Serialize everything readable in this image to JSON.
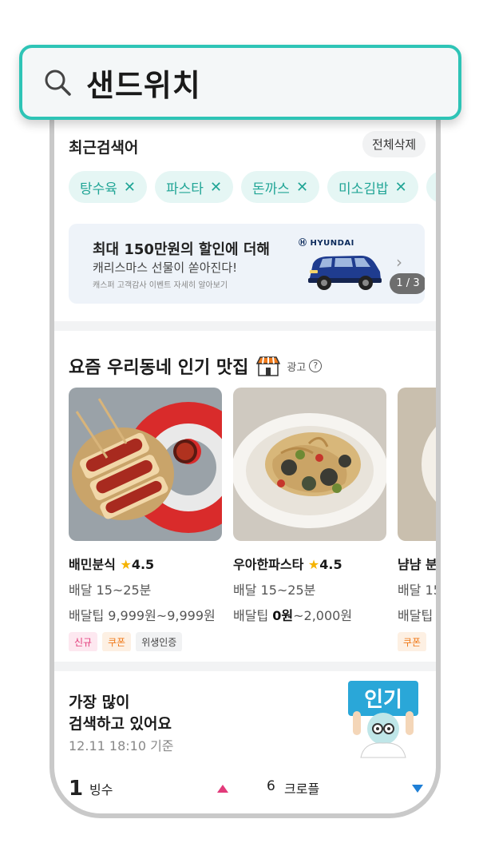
{
  "search": {
    "query": "샌드위치"
  },
  "recent": {
    "title": "최근검색어",
    "delete_all": "전체삭제",
    "chips": [
      "탕수육",
      "파스타",
      "돈까스",
      "미소김밥",
      "마"
    ]
  },
  "banner": {
    "title": "최대 150만원의 할인에 더해",
    "subtitle": "캐리스마스 선물이 쏟아진다!",
    "note": "캐스퍼 고객감사 이벤트 자세히 알아보기",
    "brand": "HYUNDAI",
    "page": "1 / 3"
  },
  "popular": {
    "title": "요즘 우리동네 인기 맛집",
    "ad_label": "광고",
    "cards": [
      {
        "name": "배민분식",
        "rating": "4.5",
        "delivery": "배달 15~25분",
        "tip_label": "배달팁",
        "tip": "9,999원~9,999원",
        "tip_bold": "",
        "badges": [
          "신규",
          "쿠폰",
          "위생인증"
        ]
      },
      {
        "name": "우아한파스타",
        "rating": "4.5",
        "delivery": "배달 15~25분",
        "tip_label": "배달팁",
        "tip": "~2,000원",
        "tip_bold": "0원",
        "badges": []
      },
      {
        "name": "냠냠 분",
        "rating": "",
        "delivery": "배달 15",
        "tip_label": "배달팁",
        "tip": "",
        "tip_bold": "",
        "badges": [
          "쿠폰"
        ]
      }
    ]
  },
  "trending": {
    "title_line1": "가장 많이",
    "title_line2": "검색하고 있어요",
    "time": "12.11 18:10 기준",
    "badge_text": "인기",
    "rank1_num": "1",
    "rank1_label": "빙수",
    "rank6_num": "6",
    "rank6_label": "크로플"
  },
  "colors": {
    "accent": "#2ec4b6",
    "chip_text": "#21a596",
    "star": "#f5b301",
    "up": "#e23a7a",
    "down": "#1e7fd6"
  }
}
